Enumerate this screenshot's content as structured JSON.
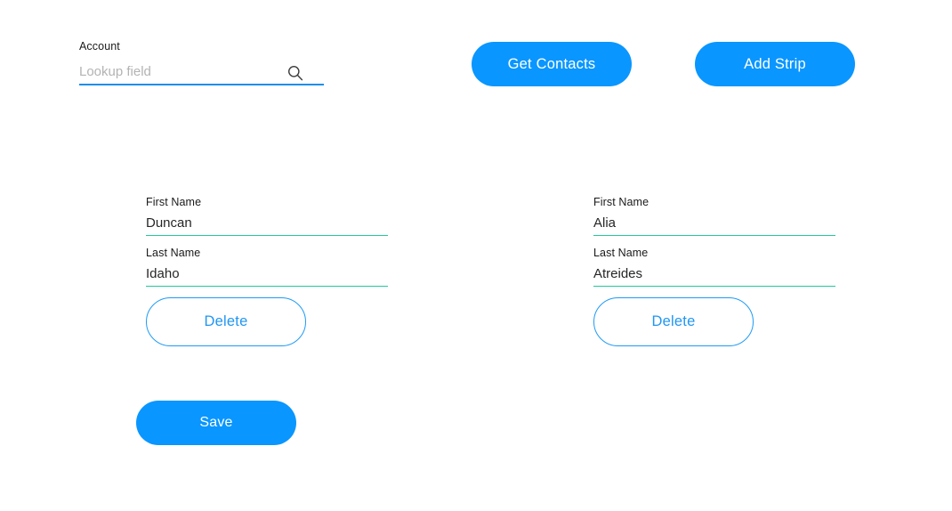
{
  "lookup": {
    "label": "Account",
    "placeholder": "Lookup field",
    "value": "",
    "icon": "search-icon",
    "underline_color": "#1d8fe8"
  },
  "toolbar": {
    "get_contacts_label": "Get Contacts",
    "add_strip_label": "Add Strip",
    "button_color": "#0a96ff",
    "button_text_color": "#ffffff"
  },
  "footer": {
    "save_label": "Save"
  },
  "strip_fields": {
    "first_name_label": "First Name",
    "last_name_label": "Last Name",
    "delete_label": "Delete",
    "underline_color": "#22c99a",
    "delete_border_color": "#1e9bf5",
    "delete_text_color": "#2196f3"
  },
  "contacts": [
    {
      "first_name_label": "First Name",
      "first_name": "Duncan",
      "last_name_label": "Last Name",
      "last_name": "Idaho",
      "delete_label": "Delete"
    },
    {
      "first_name_label": "First Name",
      "first_name": "Alia",
      "last_name_label": "Last Name",
      "last_name": "Atreides",
      "delete_label": "Delete"
    }
  ]
}
